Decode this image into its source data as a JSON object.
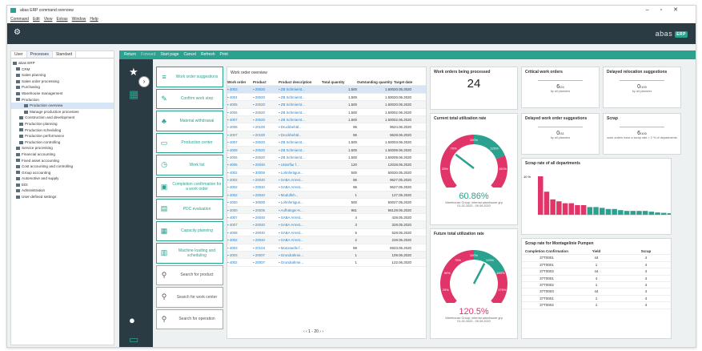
{
  "window": {
    "title": "abas ERP command overview",
    "menu": [
      "Command",
      "Edit",
      "View",
      "Extras",
      "Window",
      "Help"
    ]
  },
  "brand": "abas",
  "brand_badge": "ERP",
  "tree": {
    "tabs": [
      "User",
      "Processes",
      "Standard"
    ],
    "nodes": [
      "abas ERP",
      "CRM",
      "Sales planning",
      "Sales order processing",
      "Purchasing",
      "Warehouse management",
      "Production",
      "Production overview",
      "Manage production processes",
      "Construction and development",
      "Production planning",
      "Production scheduling",
      "Production performance",
      "Production controlling",
      "Service processing",
      "Financial accounting",
      "Fixed asset accounting",
      "Cost accounting and controlling",
      "Group accounting",
      "Automotive and supply",
      "EDI",
      "Administration",
      "User-defined settings"
    ]
  },
  "toolbar": [
    "Return",
    "Forward",
    "Start page",
    "Cancel",
    "Refresh",
    "Print"
  ],
  "actions": [
    "Work order suggestions",
    "Confirm work step",
    "Material withdrawal",
    "Production center",
    "Work list",
    "Completion confirmation for a work order",
    "PDC evaluation",
    "Capacity planning",
    "Machine loading and scheduling",
    "Search for product",
    "Search for work center",
    "Search for operation"
  ],
  "table": {
    "title": "Work order overview",
    "headers": [
      "Work order",
      "Product",
      "Product description",
      "Total quantity",
      "Outstanding quantity",
      "Target date"
    ],
    "rows": [
      [
        "4003",
        "20020",
        "ZB Schmierst...",
        "1.500",
        "1.500",
        "20.05.2020"
      ],
      [
        "4004",
        "20020",
        "ZB Schmierst...",
        "1.500",
        "1.500",
        "20.05.2020"
      ],
      [
        "4005",
        "20020",
        "ZB Schmierst...",
        "1.500",
        "1.500",
        "20.05.2020"
      ],
      [
        "4006",
        "20020",
        "ZB Schmierst...",
        "1.500",
        "1.500",
        "02.06.2020"
      ],
      [
        "4007",
        "20020",
        "ZB Schmierst...",
        "1.500",
        "1.500",
        "02.06.2020"
      ],
      [
        "4008",
        "20100",
        "Druckbehäl...",
        "96",
        "96",
        "24.06.2020"
      ],
      [
        "4007",
        "20100",
        "Druckbehäl...",
        "96",
        "96",
        "28.06.2020"
      ],
      [
        "4007",
        "20020",
        "ZB Schmierst...",
        "1.500",
        "1.500",
        "03.06.2020"
      ],
      [
        "4009",
        "20020",
        "ZB Schmierst...",
        "1.500",
        "1.500",
        "09.06.2020"
      ],
      [
        "4006",
        "20020",
        "ZB Schmierst...",
        "1.500",
        "1.500",
        "09.06.2020"
      ],
      [
        "4006",
        "20040",
        "Unterflur f...",
        "120",
        "120",
        "28.05.2020"
      ],
      [
        "4002",
        "30000",
        "Lohnfertigun...",
        "500",
        "500",
        "20.05.2020"
      ],
      [
        "4002",
        "20040",
        "SABA Arrest...",
        "96",
        "96",
        "27.05.2020"
      ],
      [
        "4002",
        "20040",
        "SABA Arrest...",
        "96",
        "96",
        "27.05.2020"
      ],
      [
        "4002",
        "20040",
        "Modulfeh...",
        "1",
        "1",
        "27.05.2020"
      ],
      [
        "4000",
        "30000",
        "Lohnfertigun...",
        "500",
        "500",
        "27.05.2020"
      ],
      [
        "4000",
        "20005",
        "Aufhänger-K...",
        "961",
        "961",
        "28.05.2020"
      ],
      [
        "4007",
        "20040",
        "SABA Arrest...",
        "4",
        "4",
        "28.05.2020"
      ],
      [
        "4007",
        "20040",
        "SABA Arrest...",
        "3",
        "3",
        "28.05.2020"
      ],
      [
        "4008",
        "20040",
        "SABA Arrest...",
        "5",
        "5",
        "28.05.2020"
      ],
      [
        "4002",
        "20040",
        "SABA Arrest...",
        "2",
        "2",
        "28.05.2020"
      ],
      [
        "4003",
        "20104",
        "Motorwelle f...",
        "69",
        "69",
        "23.05.2020"
      ],
      [
        "4003",
        "20007",
        "Grundrahme...",
        "1",
        "1",
        "09.06.2020"
      ],
      [
        "4002",
        "20007",
        "Grundrahme...",
        "1",
        "1",
        "22.06.2020"
      ]
    ],
    "pager": "1 - 20"
  },
  "kpi": {
    "title": "Work orders being processed",
    "value": "24"
  },
  "gauge1": {
    "title": "Current total utilization rate",
    "value": "60.86%",
    "level": 60.86,
    "labels": [
      "25%",
      "75%",
      "100%",
      "125%",
      "150%"
    ],
    "sub": "Warehouse Group: internal warehouse grp",
    "dates": "01.02.2020 - 09.09.2020"
  },
  "gauge2": {
    "title": "Future total utilization rate",
    "value": "120.5%",
    "level": 120.5,
    "labels": [
      "25%",
      "50%",
      "75%",
      "100%",
      "125%",
      "150%",
      "175%"
    ],
    "sub": "Warehouse Group: internal warehouse grp",
    "dates": "01.02.2020 - 09.09.2020"
  },
  "tiles": [
    {
      "title": "Critical work orders",
      "value": "6",
      "unit": "/24",
      "sub": "by all planners"
    },
    {
      "title": "Delayed relocation suggestions",
      "value": "0",
      "unit": "/100",
      "sub": "by all planners"
    },
    {
      "title": "Delayed work order suggestions",
      "value": "0",
      "unit": "/31",
      "sub": "by all planners"
    },
    {
      "title": "Scrap",
      "value": "6",
      "unit": "/100",
      "sub": "work orders have a scrap rate > 2 % of departments"
    }
  ],
  "scrapchart": {
    "title": "Scrap rate of all departments",
    "ylabel": "10 %"
  },
  "chart_data": {
    "type": "bar",
    "values": [
      10,
      6,
      4,
      3.5,
      3,
      3,
      2.5,
      2.5,
      2,
      2,
      1.8,
      1.5,
      1.5,
      1.2,
      1,
      1,
      1,
      1,
      0.8,
      0.6,
      0.5,
      0.4
    ],
    "ylim": [
      0,
      10
    ]
  },
  "scraptable": {
    "title": "Scrap rate for Montagelinie Pumpen",
    "headers": [
      "Completion Confirmation",
      "Yield",
      "Scrap"
    ],
    "rows": [
      [
        "37T0001",
        "44",
        "4"
      ],
      [
        "37T0001",
        "1",
        "4"
      ],
      [
        "37T0002",
        "44",
        "4"
      ],
      [
        "37T0001",
        "4",
        "4"
      ],
      [
        "37T0002",
        "1",
        "4"
      ],
      [
        "37T0003",
        "44",
        "4"
      ],
      [
        "37T0001",
        "1",
        "4"
      ],
      [
        "37T0002",
        "1",
        "4"
      ]
    ]
  }
}
